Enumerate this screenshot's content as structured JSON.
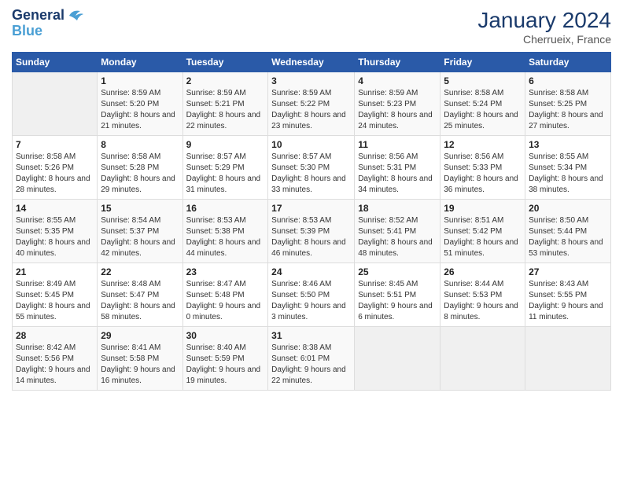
{
  "logo": {
    "line1": "General",
    "line2": "Blue"
  },
  "title": "January 2024",
  "location": "Cherrueix, France",
  "headers": [
    "Sunday",
    "Monday",
    "Tuesday",
    "Wednesday",
    "Thursday",
    "Friday",
    "Saturday"
  ],
  "weeks": [
    [
      {
        "day": "",
        "sunrise": "",
        "sunset": "",
        "daylight": ""
      },
      {
        "day": "1",
        "sunrise": "Sunrise: 8:59 AM",
        "sunset": "Sunset: 5:20 PM",
        "daylight": "Daylight: 8 hours and 21 minutes."
      },
      {
        "day": "2",
        "sunrise": "Sunrise: 8:59 AM",
        "sunset": "Sunset: 5:21 PM",
        "daylight": "Daylight: 8 hours and 22 minutes."
      },
      {
        "day": "3",
        "sunrise": "Sunrise: 8:59 AM",
        "sunset": "Sunset: 5:22 PM",
        "daylight": "Daylight: 8 hours and 23 minutes."
      },
      {
        "day": "4",
        "sunrise": "Sunrise: 8:59 AM",
        "sunset": "Sunset: 5:23 PM",
        "daylight": "Daylight: 8 hours and 24 minutes."
      },
      {
        "day": "5",
        "sunrise": "Sunrise: 8:58 AM",
        "sunset": "Sunset: 5:24 PM",
        "daylight": "Daylight: 8 hours and 25 minutes."
      },
      {
        "day": "6",
        "sunrise": "Sunrise: 8:58 AM",
        "sunset": "Sunset: 5:25 PM",
        "daylight": "Daylight: 8 hours and 27 minutes."
      }
    ],
    [
      {
        "day": "7",
        "sunrise": "Sunrise: 8:58 AM",
        "sunset": "Sunset: 5:26 PM",
        "daylight": "Daylight: 8 hours and 28 minutes."
      },
      {
        "day": "8",
        "sunrise": "Sunrise: 8:58 AM",
        "sunset": "Sunset: 5:28 PM",
        "daylight": "Daylight: 8 hours and 29 minutes."
      },
      {
        "day": "9",
        "sunrise": "Sunrise: 8:57 AM",
        "sunset": "Sunset: 5:29 PM",
        "daylight": "Daylight: 8 hours and 31 minutes."
      },
      {
        "day": "10",
        "sunrise": "Sunrise: 8:57 AM",
        "sunset": "Sunset: 5:30 PM",
        "daylight": "Daylight: 8 hours and 33 minutes."
      },
      {
        "day": "11",
        "sunrise": "Sunrise: 8:56 AM",
        "sunset": "Sunset: 5:31 PM",
        "daylight": "Daylight: 8 hours and 34 minutes."
      },
      {
        "day": "12",
        "sunrise": "Sunrise: 8:56 AM",
        "sunset": "Sunset: 5:33 PM",
        "daylight": "Daylight: 8 hours and 36 minutes."
      },
      {
        "day": "13",
        "sunrise": "Sunrise: 8:55 AM",
        "sunset": "Sunset: 5:34 PM",
        "daylight": "Daylight: 8 hours and 38 minutes."
      }
    ],
    [
      {
        "day": "14",
        "sunrise": "Sunrise: 8:55 AM",
        "sunset": "Sunset: 5:35 PM",
        "daylight": "Daylight: 8 hours and 40 minutes."
      },
      {
        "day": "15",
        "sunrise": "Sunrise: 8:54 AM",
        "sunset": "Sunset: 5:37 PM",
        "daylight": "Daylight: 8 hours and 42 minutes."
      },
      {
        "day": "16",
        "sunrise": "Sunrise: 8:53 AM",
        "sunset": "Sunset: 5:38 PM",
        "daylight": "Daylight: 8 hours and 44 minutes."
      },
      {
        "day": "17",
        "sunrise": "Sunrise: 8:53 AM",
        "sunset": "Sunset: 5:39 PM",
        "daylight": "Daylight: 8 hours and 46 minutes."
      },
      {
        "day": "18",
        "sunrise": "Sunrise: 8:52 AM",
        "sunset": "Sunset: 5:41 PM",
        "daylight": "Daylight: 8 hours and 48 minutes."
      },
      {
        "day": "19",
        "sunrise": "Sunrise: 8:51 AM",
        "sunset": "Sunset: 5:42 PM",
        "daylight": "Daylight: 8 hours and 51 minutes."
      },
      {
        "day": "20",
        "sunrise": "Sunrise: 8:50 AM",
        "sunset": "Sunset: 5:44 PM",
        "daylight": "Daylight: 8 hours and 53 minutes."
      }
    ],
    [
      {
        "day": "21",
        "sunrise": "Sunrise: 8:49 AM",
        "sunset": "Sunset: 5:45 PM",
        "daylight": "Daylight: 8 hours and 55 minutes."
      },
      {
        "day": "22",
        "sunrise": "Sunrise: 8:48 AM",
        "sunset": "Sunset: 5:47 PM",
        "daylight": "Daylight: 8 hours and 58 minutes."
      },
      {
        "day": "23",
        "sunrise": "Sunrise: 8:47 AM",
        "sunset": "Sunset: 5:48 PM",
        "daylight": "Daylight: 9 hours and 0 minutes."
      },
      {
        "day": "24",
        "sunrise": "Sunrise: 8:46 AM",
        "sunset": "Sunset: 5:50 PM",
        "daylight": "Daylight: 9 hours and 3 minutes."
      },
      {
        "day": "25",
        "sunrise": "Sunrise: 8:45 AM",
        "sunset": "Sunset: 5:51 PM",
        "daylight": "Daylight: 9 hours and 6 minutes."
      },
      {
        "day": "26",
        "sunrise": "Sunrise: 8:44 AM",
        "sunset": "Sunset: 5:53 PM",
        "daylight": "Daylight: 9 hours and 8 minutes."
      },
      {
        "day": "27",
        "sunrise": "Sunrise: 8:43 AM",
        "sunset": "Sunset: 5:55 PM",
        "daylight": "Daylight: 9 hours and 11 minutes."
      }
    ],
    [
      {
        "day": "28",
        "sunrise": "Sunrise: 8:42 AM",
        "sunset": "Sunset: 5:56 PM",
        "daylight": "Daylight: 9 hours and 14 minutes."
      },
      {
        "day": "29",
        "sunrise": "Sunrise: 8:41 AM",
        "sunset": "Sunset: 5:58 PM",
        "daylight": "Daylight: 9 hours and 16 minutes."
      },
      {
        "day": "30",
        "sunrise": "Sunrise: 8:40 AM",
        "sunset": "Sunset: 5:59 PM",
        "daylight": "Daylight: 9 hours and 19 minutes."
      },
      {
        "day": "31",
        "sunrise": "Sunrise: 8:38 AM",
        "sunset": "Sunset: 6:01 PM",
        "daylight": "Daylight: 9 hours and 22 minutes."
      },
      {
        "day": "",
        "sunrise": "",
        "sunset": "",
        "daylight": ""
      },
      {
        "day": "",
        "sunrise": "",
        "sunset": "",
        "daylight": ""
      },
      {
        "day": "",
        "sunrise": "",
        "sunset": "",
        "daylight": ""
      }
    ]
  ]
}
